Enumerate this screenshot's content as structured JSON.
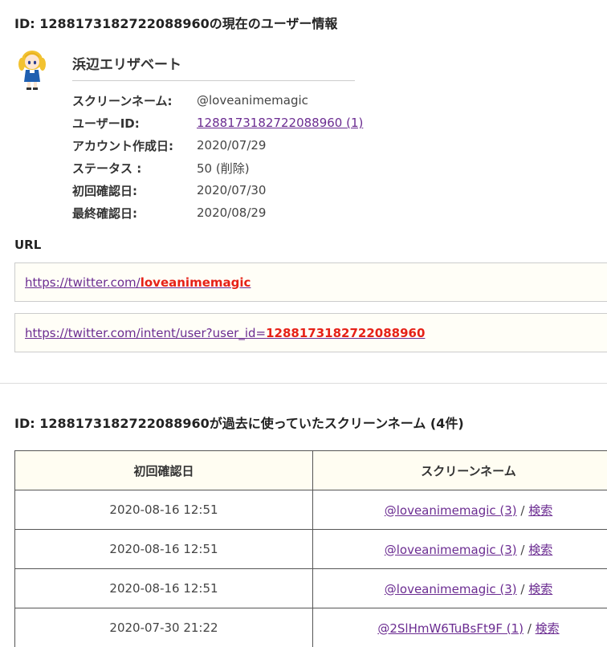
{
  "current": {
    "title": "ID: 1288173182722088960の現在のユーザー情報",
    "display_name": "浜辺エリザベート",
    "fields": [
      {
        "label": "スクリーンネーム:",
        "value": "@loveanimemagic",
        "link": false
      },
      {
        "label": "ユーザーID:",
        "value": "1288173182722088960 (1)",
        "link": true
      },
      {
        "label": "アカウント作成日:",
        "value": "2020/07/29",
        "link": false
      },
      {
        "label": "ステータス :",
        "value": "50 (削除)",
        "link": false
      },
      {
        "label": "初回確認日:",
        "value": "2020/07/30",
        "link": false
      },
      {
        "label": "最終確認日:",
        "value": "2020/08/29",
        "link": false
      }
    ]
  },
  "urls": {
    "label": "URL",
    "url1_prefix": "https://twitter.com/",
    "url1_highlight": "loveanimemagic",
    "url2_prefix": "https://twitter.com/intent/user?user_id=",
    "url2_highlight": "1288173182722088960"
  },
  "history": {
    "title": "ID: 1288173182722088960が過去に使っていたスクリーンネーム (4件)",
    "headers": [
      "初回確認日",
      "スクリーンネーム"
    ],
    "rows": [
      {
        "date": "2020-08-16 12:51",
        "name": "@loveanimemagic (3)",
        "sep": " / ",
        "search": "検索"
      },
      {
        "date": "2020-08-16 12:51",
        "name": "@loveanimemagic (3)",
        "sep": " / ",
        "search": "検索"
      },
      {
        "date": "2020-08-16 12:51",
        "name": "@loveanimemagic (3)",
        "sep": " / ",
        "search": "検索"
      },
      {
        "date": "2020-07-30 21:22",
        "name": "@2SlHmW6TuBsFt9F (1)",
        "sep": " / ",
        "search": "検索"
      }
    ]
  },
  "colors": {
    "link": "#6b2c91",
    "highlight": "#e62117",
    "box_background": "#fffef7"
  }
}
